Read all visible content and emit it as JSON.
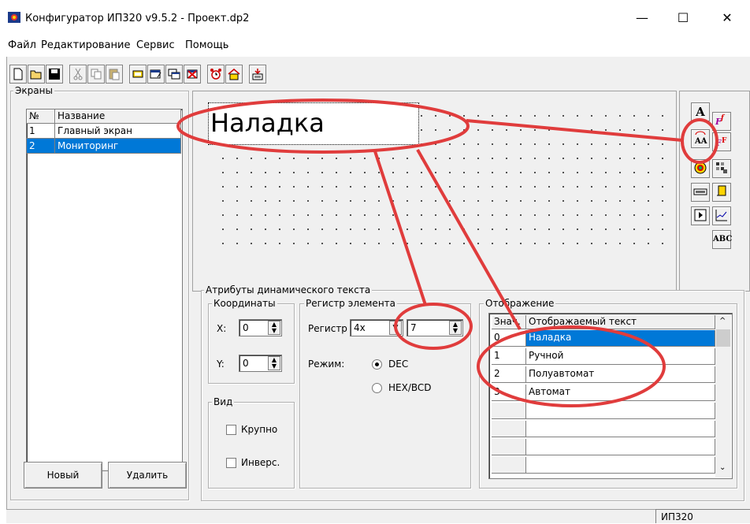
{
  "window": {
    "title": "Конфигуратор ИП320 v9.5.2 - Проект.dp2",
    "min": "—",
    "max": "☐",
    "close": "✕"
  },
  "menu": [
    "Файл",
    "Редактирование",
    "Сервис",
    "Помощь"
  ],
  "screens": {
    "group_title": "Экраны",
    "col_num": "№",
    "col_name": "Название",
    "rows": [
      {
        "num": "1",
        "name": "Главный экран"
      },
      {
        "num": "2",
        "name": "Мониторинг"
      }
    ],
    "new_button": "Новый",
    "delete_button": "Удалить"
  },
  "canvas": {
    "text": "Наладка"
  },
  "attributes": {
    "group_title": "Атрибуты динамического текста",
    "coords": {
      "title": "Координаты",
      "x_label": "X:",
      "x_value": "0",
      "y_label": "Y:",
      "y_value": "0"
    },
    "view": {
      "title": "Вид",
      "large_label": "Крупно",
      "invert_label": "Инверс."
    },
    "register": {
      "title": "Регистр элемента",
      "reg_label": "Регистр №",
      "reg_type": "4x",
      "reg_value": "7",
      "mode_label": "Режим:",
      "mode_dec": "DEC",
      "mode_hex": "HEX/BCD"
    },
    "display": {
      "title": "Отображение",
      "col_value": "Знач.",
      "col_text": "Отображаемый текст",
      "rows": [
        {
          "value": "0",
          "text": "Наладка"
        },
        {
          "value": "1",
          "text": "Ручной"
        },
        {
          "value": "2",
          "text": "Полуавтомат"
        },
        {
          "value": "3",
          "text": "Автомат"
        }
      ]
    }
  },
  "palette": {
    "text_btn": "A",
    "abc_btn": "ABC"
  },
  "status": {
    "device": "ИП320"
  },
  "colors": {
    "selection": "#0078d7",
    "annotation": "#e03c3c"
  }
}
